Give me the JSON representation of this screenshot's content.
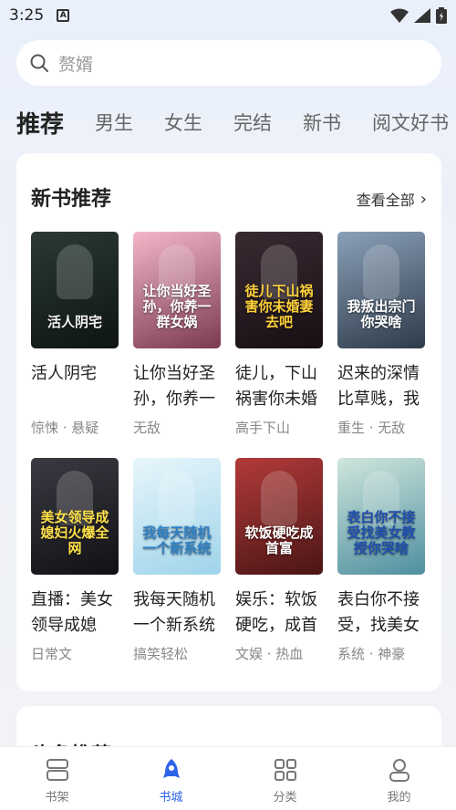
{
  "status": {
    "time": "3:25",
    "a_icon": "A"
  },
  "search": {
    "placeholder": "赘婿"
  },
  "tabs": [
    {
      "label": "推荐",
      "active": true
    },
    {
      "label": "男生"
    },
    {
      "label": "女生"
    },
    {
      "label": "完结"
    },
    {
      "label": "新书"
    },
    {
      "label": "阅文好书"
    }
  ],
  "section": {
    "title": "新书推荐",
    "see_all": "查看全部"
  },
  "books": [
    {
      "title": "活人阴宅",
      "tags": "惊悚 · 悬疑",
      "cover_text": "活人阴宅",
      "cover_colors": [
        "#2a3a33",
        "#0e1512"
      ],
      "text_color": "#f3f3f3"
    },
    {
      "title": "让你当好圣孙，你养一",
      "tags": "无敌",
      "cover_text": "让你当好圣孙，你养一群女娲",
      "cover_colors": [
        "#f3b6c8",
        "#7b3a52"
      ],
      "text_color": "#ffffff"
    },
    {
      "title": "徒儿，下山祸害你未婚",
      "tags": "高手下山",
      "cover_text": "徒儿下山祸害你未婚妻去吧",
      "cover_colors": [
        "#3a2a32",
        "#170f14"
      ],
      "text_color": "#ffd23a"
    },
    {
      "title": "迟来的深情比草贱，我",
      "tags": "重生 · 无敌",
      "cover_text": "我叛出宗门你哭啥",
      "cover_colors": [
        "#8aa0b8",
        "#2e3b4a"
      ],
      "text_color": "#ffffff"
    },
    {
      "title": "直播：美女领导成媳",
      "tags": "日常文",
      "cover_text": "美女领导成媳妇火爆全网",
      "cover_colors": [
        "#3a3a42",
        "#101015"
      ],
      "text_color": "#ffe14a"
    },
    {
      "title": "我每天随机一个新系统",
      "tags": "搞笑轻松",
      "cover_text": "我每天随机一个新系统",
      "cover_colors": [
        "#e8f6fb",
        "#9fd4ea"
      ],
      "text_color": "#2f80c7"
    },
    {
      "title": "娱乐：软饭硬吃，成首",
      "tags": "文娱 · 热血",
      "cover_text": "软饭硬吃成首富",
      "cover_colors": [
        "#b33a3a",
        "#4a1515"
      ],
      "text_color": "#ffffff"
    },
    {
      "title": "表白你不接受，找美女",
      "tags": "系统 · 神豪",
      "cover_text": "表白你不接受找美女教授你哭啥",
      "cover_colors": [
        "#cfe6dc",
        "#4f8fa0"
      ],
      "text_color": "#1e4fb0"
    }
  ],
  "section2": {
    "title": "头条推荐"
  },
  "nav": [
    {
      "label": "书架",
      "icon": "bookshelf-icon"
    },
    {
      "label": "书城",
      "icon": "bookstore-icon",
      "active": true
    },
    {
      "label": "分类",
      "icon": "category-icon"
    },
    {
      "label": "我的",
      "icon": "profile-icon"
    }
  ],
  "colors": {
    "accent": "#2d63e8"
  }
}
